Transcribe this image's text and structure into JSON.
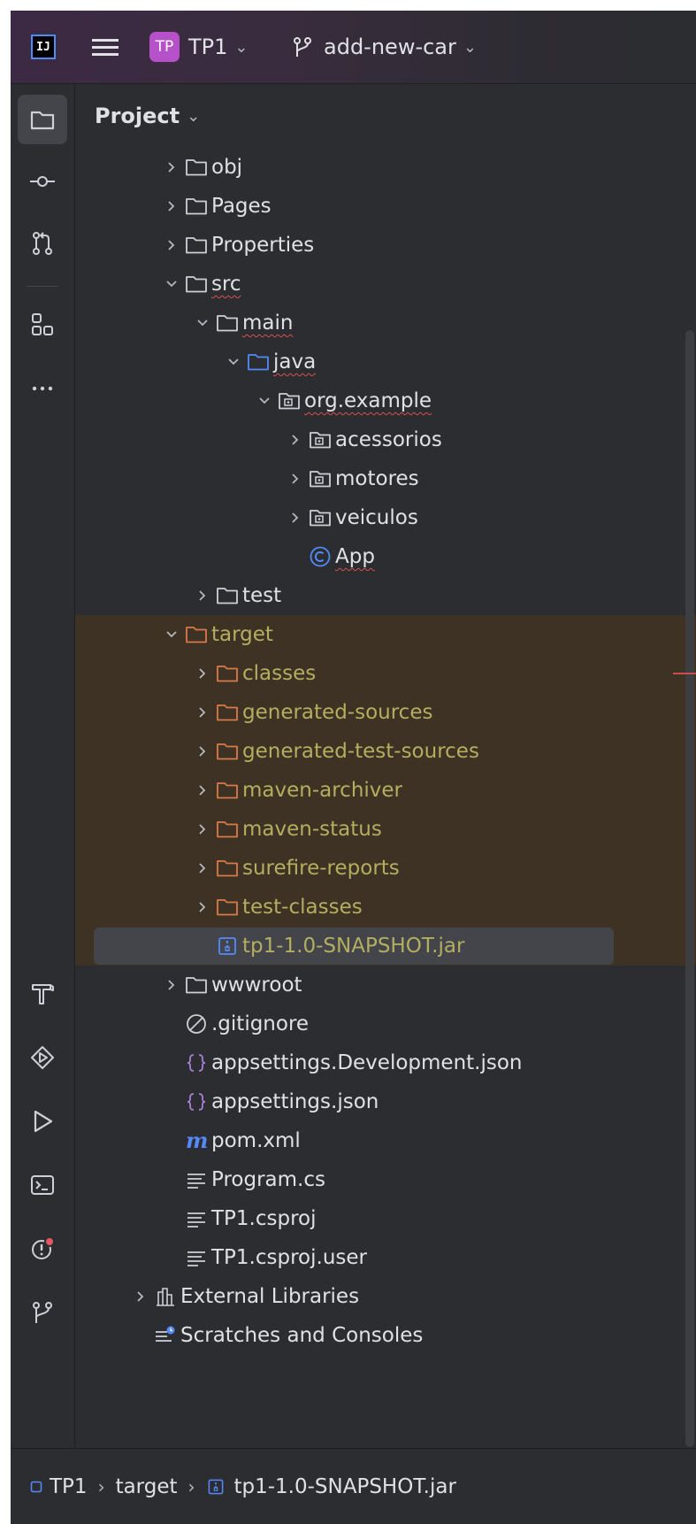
{
  "titlebar": {
    "logo_text": "IJ",
    "project_badge": "TP",
    "project_name": "TP1",
    "branch_name": "add-new-car",
    "chevron": "⌄"
  },
  "panel": {
    "title": "Project",
    "chevron": "⌄"
  },
  "stripe_icons": [
    "folder-icon",
    "commit-icon",
    "pull-request-icon",
    "structure-icon",
    "more-icon",
    "build-icon",
    "services-icon",
    "run-icon",
    "terminal-icon",
    "problems-icon",
    "git-icon"
  ],
  "tree": [
    {
      "label": "obj",
      "depth": 2,
      "arrow": "right",
      "icon": "folder"
    },
    {
      "label": "Pages",
      "depth": 2,
      "arrow": "right",
      "icon": "folder"
    },
    {
      "label": "Properties",
      "depth": 2,
      "arrow": "right",
      "icon": "folder"
    },
    {
      "label": "src",
      "depth": 2,
      "arrow": "down",
      "icon": "folder",
      "squiggle": true
    },
    {
      "label": "main",
      "depth": 3,
      "arrow": "down",
      "icon": "folder",
      "squiggle": true
    },
    {
      "label": "java",
      "depth": 4,
      "arrow": "down",
      "icon": "source-folder",
      "squiggle": true
    },
    {
      "label": "org.example",
      "depth": 5,
      "arrow": "down",
      "icon": "package",
      "squiggle": true
    },
    {
      "label": "acessorios",
      "depth": 6,
      "arrow": "right",
      "icon": "package"
    },
    {
      "label": "motores",
      "depth": 6,
      "arrow": "right",
      "icon": "package"
    },
    {
      "label": "veiculos",
      "depth": 6,
      "arrow": "right",
      "icon": "package"
    },
    {
      "label": "App",
      "depth": 6,
      "arrow": "none",
      "icon": "class",
      "squiggle": true
    },
    {
      "label": "test",
      "depth": 3,
      "arrow": "right",
      "icon": "folder"
    },
    {
      "label": "target",
      "depth": 2,
      "arrow": "down",
      "icon": "excluded-folder",
      "excluded": true
    },
    {
      "label": "classes",
      "depth": 3,
      "arrow": "right",
      "icon": "excluded-folder",
      "excluded": true
    },
    {
      "label": "generated-sources",
      "depth": 3,
      "arrow": "right",
      "icon": "excluded-folder",
      "excluded": true
    },
    {
      "label": "generated-test-sources",
      "depth": 3,
      "arrow": "right",
      "icon": "excluded-folder",
      "excluded": true
    },
    {
      "label": "maven-archiver",
      "depth": 3,
      "arrow": "right",
      "icon": "excluded-folder",
      "excluded": true
    },
    {
      "label": "maven-status",
      "depth": 3,
      "arrow": "right",
      "icon": "excluded-folder",
      "excluded": true
    },
    {
      "label": "surefire-reports",
      "depth": 3,
      "arrow": "right",
      "icon": "excluded-folder",
      "excluded": true
    },
    {
      "label": "test-classes",
      "depth": 3,
      "arrow": "right",
      "icon": "excluded-folder",
      "excluded": true
    },
    {
      "label": "tp1-1.0-SNAPSHOT.jar",
      "depth": 3,
      "arrow": "none",
      "icon": "jar",
      "excluded": true,
      "selected": true
    },
    {
      "label": "wwwroot",
      "depth": 2,
      "arrow": "right",
      "icon": "folder"
    },
    {
      "label": ".gitignore",
      "depth": 2,
      "arrow": "none",
      "icon": "ignore"
    },
    {
      "label": "appsettings.Development.json",
      "depth": 2,
      "arrow": "none",
      "icon": "json"
    },
    {
      "label": "appsettings.json",
      "depth": 2,
      "arrow": "none",
      "icon": "json"
    },
    {
      "label": "pom.xml",
      "depth": 2,
      "arrow": "none",
      "icon": "maven"
    },
    {
      "label": "Program.cs",
      "depth": 2,
      "arrow": "none",
      "icon": "text"
    },
    {
      "label": "TP1.csproj",
      "depth": 2,
      "arrow": "none",
      "icon": "text"
    },
    {
      "label": "TP1.csproj.user",
      "depth": 2,
      "arrow": "none",
      "icon": "text"
    },
    {
      "label": "External Libraries",
      "depth": 1,
      "arrow": "right",
      "icon": "library"
    },
    {
      "label": "Scratches and Consoles",
      "depth": 1,
      "arrow": "none",
      "icon": "scratches"
    }
  ],
  "statusbar": {
    "crumbs": [
      "TP1",
      "target",
      "tp1-1.0-SNAPSHOT.jar"
    ],
    "separator": "›"
  },
  "colors": {
    "background": "#2b2d30",
    "text": "#dfe1e5",
    "excluded_text": "#b3ae60",
    "excluded_bg": "#3d3223",
    "excluded_folder": "#d97a4a",
    "selection": "#43454a",
    "badge": "#b751c9",
    "accent_blue": "#548af7"
  }
}
